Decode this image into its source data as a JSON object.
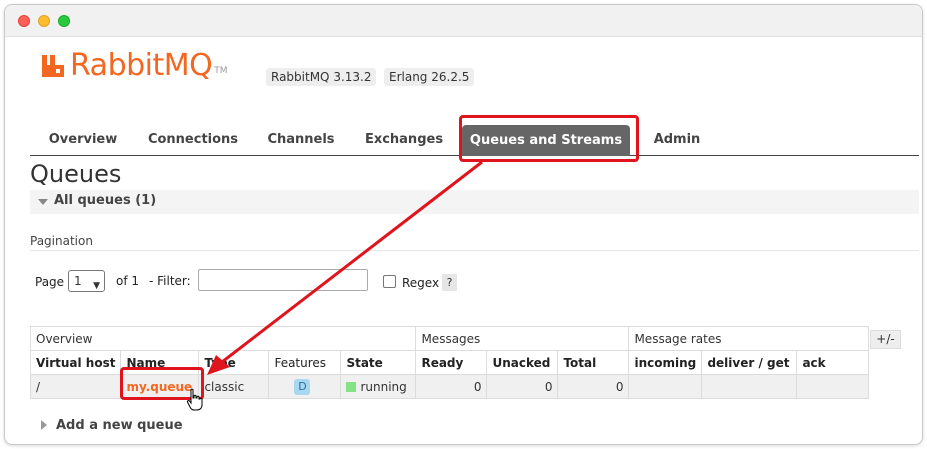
{
  "window": {
    "controls": [
      "close",
      "minimize",
      "maximize"
    ]
  },
  "brand": {
    "name": "RabbitMQ",
    "tm": "TM",
    "color": "#f26822"
  },
  "badges": {
    "rabbitmq_version": "RabbitMQ 3.13.2",
    "erlang_version": "Erlang 26.2.5"
  },
  "tabs": [
    {
      "label": "Overview",
      "active": false
    },
    {
      "label": "Connections",
      "active": false
    },
    {
      "label": "Channels",
      "active": false
    },
    {
      "label": "Exchanges",
      "active": false
    },
    {
      "label": "Queues and Streams",
      "active": true
    },
    {
      "label": "Admin",
      "active": false
    }
  ],
  "page": {
    "title": "Queues",
    "section_title": "All queues (1)"
  },
  "pagination": {
    "section_label": "Pagination",
    "page_label": "Page",
    "page_value": "1",
    "of_label": "of 1",
    "filter_label": "- Filter:",
    "filter_value": "",
    "regex_label": "Regex",
    "regex_checked": false,
    "help_label": "?"
  },
  "table": {
    "groups": [
      "Overview",
      "Messages",
      "Message rates"
    ],
    "columns": [
      "Virtual host",
      "Name",
      "Type",
      "Features",
      "State",
      "Ready",
      "Unacked",
      "Total",
      "incoming",
      "deliver / get",
      "ack"
    ],
    "rows": [
      {
        "vhost": "/",
        "name": "my.queue",
        "type": "classic",
        "features": "D",
        "state": "running",
        "ready": "0",
        "unacked": "0",
        "total": "0",
        "incoming": "",
        "deliver_get": "",
        "ack": ""
      }
    ],
    "toggle_columns_label": "+/-"
  },
  "add_queue": {
    "label": "Add a new queue"
  },
  "annotation_color": "#e0141c"
}
